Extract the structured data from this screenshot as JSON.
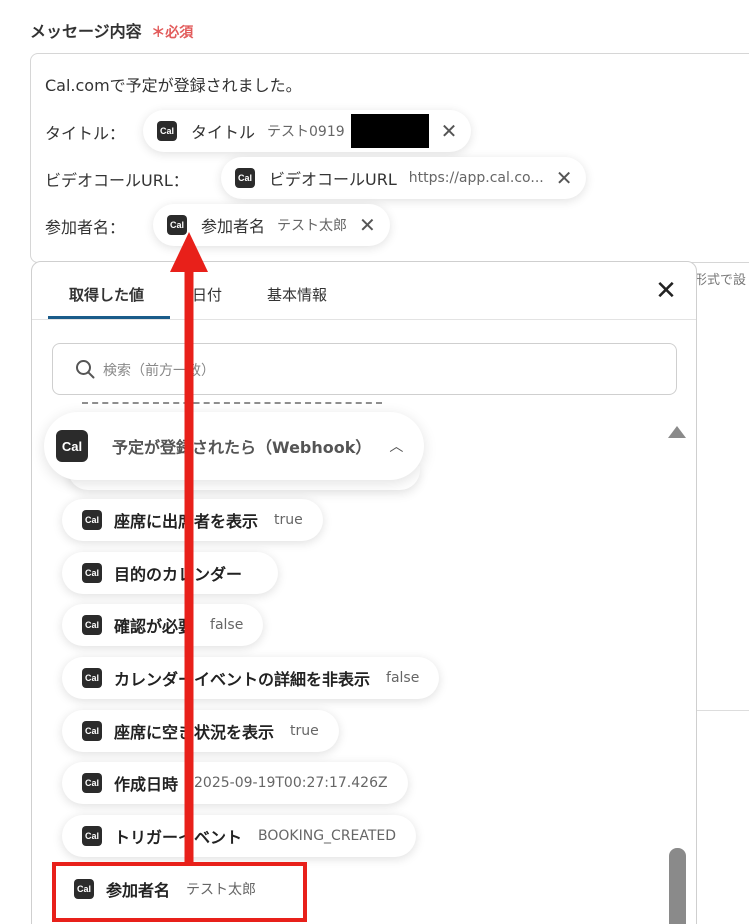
{
  "field": {
    "label": "メッセージ内容",
    "required_mark": "＊",
    "required_text": "必須"
  },
  "editor": {
    "first_line": "Cal.comで予定が登録されました。",
    "lines": [
      {
        "prefix": "タイトル：",
        "chip_name": "タイトル",
        "chip_value": "テスト0919"
      },
      {
        "prefix": "ビデオコールURL：",
        "chip_name": "ビデオコールURL",
        "chip_value": "https://app.cal.co..."
      },
      {
        "prefix": "参加者名：",
        "chip_name": "参加者名",
        "chip_value": "テスト太郎"
      }
    ]
  },
  "side_hint": "形式で設",
  "panel": {
    "tabs": [
      {
        "label": "取得した値"
      },
      {
        "label": "日付"
      },
      {
        "label": "基本情報"
      }
    ],
    "active_tab": 0,
    "close_glyph": "✕",
    "search": {
      "placeholder": "検索（前方一致）"
    },
    "group": {
      "icon_text": "Cal",
      "title": "予定が登録されたら（Webhook）",
      "chevron": "⌃"
    },
    "items": [
      {
        "name": "座席に出席者を表示",
        "value": "true"
      },
      {
        "name": "目的のカレンダー",
        "value": ""
      },
      {
        "name": "確認が必要",
        "value": "false"
      },
      {
        "name": "カレンダーイベントの詳細を非表示",
        "value": "false"
      },
      {
        "name": "座席に空き状況を表示",
        "value": "true"
      },
      {
        "name": "作成日時",
        "value": "2025-09-19T00:27:17.426Z"
      },
      {
        "name": "トリガーイベント",
        "value": "BOOKING_CREATED"
      },
      {
        "name": "参加者名",
        "value": "テスト太郎"
      }
    ]
  },
  "icon_text": "Cal",
  "remove_glyph": "✕",
  "colors": {
    "highlight": "#e8201a",
    "accent_tab": "#1a5c8a",
    "required": "#e25b5b",
    "cal_icon_bg": "#2b2b2b"
  },
  "icons": [
    "search-icon",
    "close-icon",
    "cal-icon",
    "chevron-up-icon",
    "remove-icon"
  ]
}
